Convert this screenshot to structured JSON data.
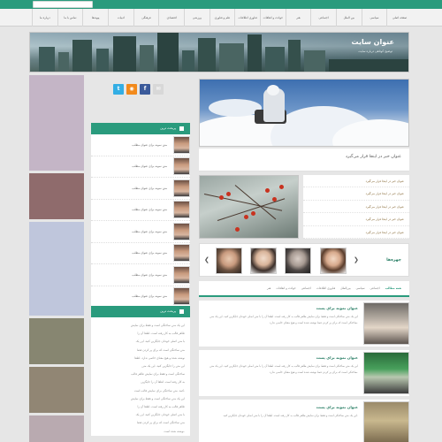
{
  "header": {
    "search_placeholder": "",
    "nav_items": [
      "صفحه اصلی",
      "سیاسی",
      "بین الملل",
      "اجتماعی",
      "هنر",
      "حوادث و اتفاقات",
      "فناوری اطلاعات",
      "علم و فناوری",
      "ورزشی",
      "اقتصادی",
      "فرهنگی",
      "ادبیات",
      "پیوندها",
      "تماس با ما",
      "درباره ما"
    ]
  },
  "banner": {
    "site_title": "عنوان سایت",
    "site_tagline": "توضیح کوتاهی درباره سایت"
  },
  "social": [
    {
      "icon": "twitter-icon",
      "color": "#33aee4",
      "glyph": "t"
    },
    {
      "icon": "rss-icon",
      "color": "#f28a1c",
      "glyph": "◉"
    },
    {
      "icon": "facebook-icon",
      "color": "#3b5a9a",
      "glyph": "f"
    },
    {
      "icon": "email-icon",
      "color": "#d8d8d8",
      "glyph": "✉"
    }
  ],
  "left_boxes": [
    {
      "color": "#c4b5c6",
      "height": 108
    },
    {
      "color": "#8f6b6c",
      "height": 52
    },
    {
      "color": "#bfc6dc",
      "height": 106
    },
    {
      "color": "#878671",
      "height": 52
    },
    {
      "color": "#918674",
      "height": 52
    },
    {
      "color": "#b9aab0",
      "height": 30
    }
  ],
  "sidebar": {
    "recent_title": "پربحث ترین",
    "recent_items": [
      "متن نمونه برای عنوان مطلب",
      "متن نمونه برای عنوان مطلب",
      "متن نمونه برای عنوان مطلب",
      "متن نمونه برای عنوان مطلب",
      "متن نمونه برای عنوان مطلب",
      "متن نمونه برای عنوان مطلب",
      "متن نمونه برای عنوان مطلب",
      "متن نمونه برای عنوان مطلب"
    ],
    "box2_title": "پربحث ترین",
    "box2_lines": [
      "این یک متن ساختگی است و فقط برای نمایش",
      "ظاهر قالب به کار رفته است. لطفا آن را",
      "با متن اصلی خودتان جایگزین کنید. این یک",
      "متن ساختگی است که برای پر کردن فضا",
      "نوشته شده و هیچ معنای خاصی ندارد. لطفا",
      "این متن را جایگزین کنید. این یک متن",
      "ساختگی است و فقط برای نمایش ظاهر قالب",
      "به کار رفته است. لطفا آن را جایگزین",
      "کنید. متن ساختگی برای نمایش قالب است.",
      "این یک متن ساختگی است و فقط برای نمایش",
      "ظاهر قالب به کار رفته است. لطفا آن را",
      "با متن اصلی خودتان جایگزین کنید. این یک",
      "متن ساختگی است که برای پر کردن فضا",
      "نوشته شده است."
    ]
  },
  "main": {
    "hero_title": "عنوان خبر در اینجا قرار می‌گیرد",
    "mid_links": [
      "عنوان خبر در اینجا قرار می‌گیرد",
      "عنوان خبر در اینجا قرار می‌گیرد",
      "عنوان خبر در اینجا قرار می‌گیرد",
      "عنوان خبر در اینجا قرار می‌گیرد",
      "عنوان خبر در اینجا قرار می‌گیرد"
    ],
    "people_label": "چهره‌ها",
    "tabs": [
      "همه مطالب",
      "اجتماعی",
      "سیاسی",
      "بین‌الملل",
      "فناوری اطلاعات",
      "اجتماعی",
      "حوادث و اتفاقات",
      "هنر"
    ],
    "news": [
      {
        "title": "عنوان نمونه برای پست",
        "body": "این یک متن ساختگی است و فقط برای نمایش ظاهر قالب به کار رفته است. لطفا آن را با متن اصلی خودتان جایگزین کنید. این یک متن ساختگی است که برای پر کردن فضا نوشته شده است و هیچ معنای خاصی ندارد."
      },
      {
        "title": "عنوان نمونه برای پست",
        "body": "این یک متن ساختگی است و فقط برای نمایش ظاهر قالب به کار رفته است. لطفا آن را با متن اصلی خودتان جایگزین کنید. این یک متن ساختگی است که برای پر کردن فضا نوشته شده است و هیچ معنای خاصی ندارد."
      },
      {
        "title": "عنوان نمونه برای پست",
        "body": "این یک متن ساختگی است و فقط برای نمایش ظاهر قالب به کار رفته است. لطفا آن را با متن اصلی خودتان جایگزین کنید."
      }
    ]
  },
  "colors": {
    "accent": "#2a9b7d",
    "background": "#e6e6e6"
  }
}
